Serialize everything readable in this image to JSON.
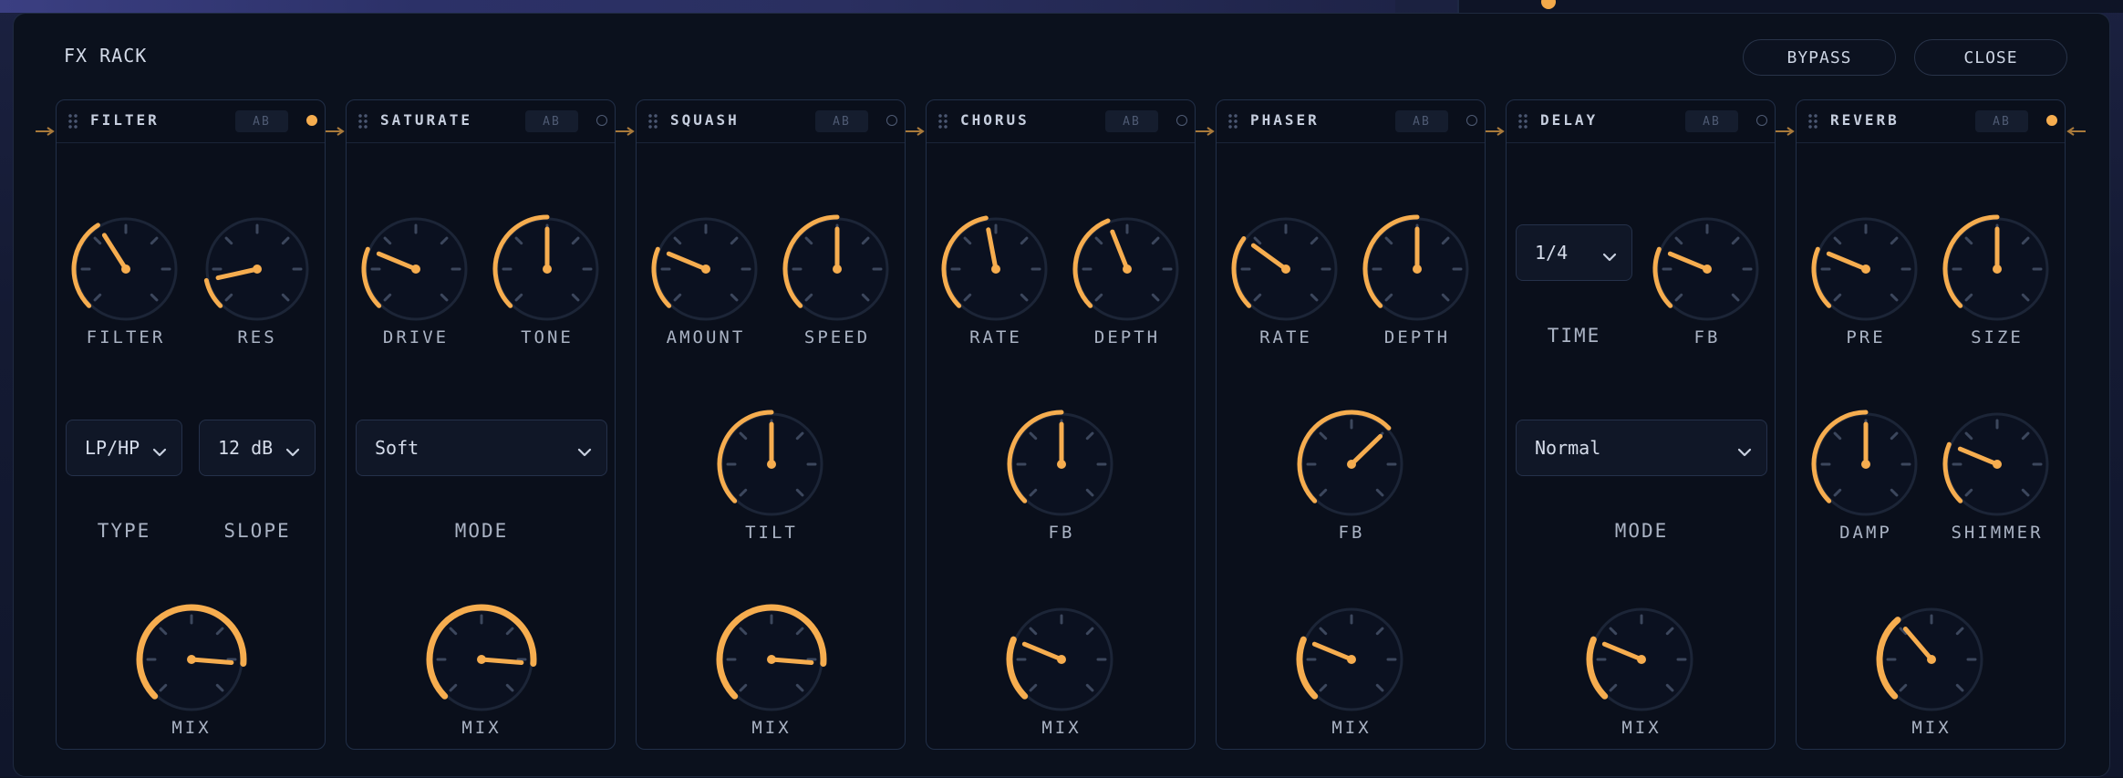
{
  "app": {
    "title": "FX RACK"
  },
  "header": {
    "bypass_label": "BYPASS",
    "close_label": "CLOSE"
  },
  "colors": {
    "accent": "#f6ad4f",
    "panel": "#0b111d",
    "border": "#223049",
    "dim": "#2a3448"
  },
  "modules": [
    {
      "name": "FILTER",
      "ab": "AB",
      "active": true,
      "knobs": [
        {
          "label": "FILTER",
          "value": 0.38,
          "slot": "tl"
        },
        {
          "label": "RES",
          "value": 0.12,
          "slot": "tr"
        },
        {
          "label": "MIX",
          "value": 0.85,
          "slot": "bot"
        }
      ],
      "selects": [
        {
          "value": "LP/HP",
          "label": "TYPE",
          "slot": "l"
        },
        {
          "value": "12 dB",
          "label": "SLOPE",
          "slot": "r"
        }
      ]
    },
    {
      "name": "SATURATE",
      "ab": "AB",
      "active": false,
      "knobs": [
        {
          "label": "DRIVE",
          "value": 0.25,
          "slot": "tl"
        },
        {
          "label": "TONE",
          "value": 0.5,
          "slot": "tr"
        },
        {
          "label": "MIX",
          "value": 0.85,
          "slot": "bot"
        }
      ],
      "selects": [
        {
          "value": "Soft",
          "label": "MODE",
          "slot": "wide"
        }
      ]
    },
    {
      "name": "SQUASH",
      "ab": "AB",
      "active": false,
      "knobs": [
        {
          "label": "AMOUNT",
          "value": 0.25,
          "slot": "tl"
        },
        {
          "label": "SPEED",
          "value": 0.5,
          "slot": "tr"
        },
        {
          "label": "TILT",
          "value": 0.5,
          "slot": "mid"
        },
        {
          "label": "MIX",
          "value": 0.85,
          "slot": "bot"
        }
      ],
      "selects": []
    },
    {
      "name": "CHORUS",
      "ab": "AB",
      "active": false,
      "knobs": [
        {
          "label": "RATE",
          "value": 0.46,
          "slot": "tl"
        },
        {
          "label": "DEPTH",
          "value": 0.42,
          "slot": "tr"
        },
        {
          "label": "FB",
          "value": 0.5,
          "slot": "mid"
        },
        {
          "label": "MIX",
          "value": 0.25,
          "slot": "bot"
        }
      ],
      "selects": []
    },
    {
      "name": "PHASER",
      "ab": "AB",
      "active": false,
      "knobs": [
        {
          "label": "RATE",
          "value": 0.3,
          "slot": "tl"
        },
        {
          "label": "DEPTH",
          "value": 0.5,
          "slot": "tr"
        },
        {
          "label": "FB",
          "value": 0.67,
          "slot": "mid"
        },
        {
          "label": "MIX",
          "value": 0.25,
          "slot": "bot"
        }
      ],
      "selects": []
    },
    {
      "name": "DELAY",
      "ab": "AB",
      "active": false,
      "knobs": [
        {
          "label": "FB",
          "value": 0.25,
          "slot": "tr"
        },
        {
          "label": "MIX",
          "value": 0.25,
          "slot": "bot"
        }
      ],
      "selects": [
        {
          "value": "1/4",
          "label": "TIME",
          "slot": "small"
        },
        {
          "value": "Normal",
          "label": "MODE",
          "slot": "wide"
        }
      ]
    },
    {
      "name": "REVERB",
      "ab": "AB",
      "active": true,
      "knobs": [
        {
          "label": "PRE",
          "value": 0.25,
          "slot": "tl"
        },
        {
          "label": "SIZE",
          "value": 0.5,
          "slot": "tr"
        },
        {
          "label": "DAMP",
          "value": 0.5,
          "slot": "ml"
        },
        {
          "label": "SHIMMER",
          "value": 0.25,
          "slot": "mr"
        },
        {
          "label": "MIX",
          "value": 0.35,
          "slot": "bot"
        }
      ],
      "selects": []
    }
  ]
}
